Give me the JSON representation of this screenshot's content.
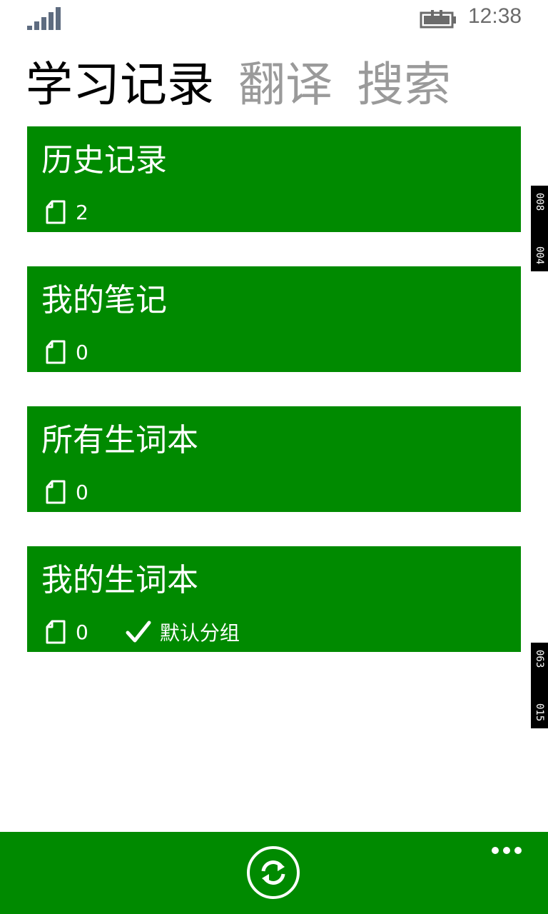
{
  "status": {
    "time": "12:38"
  },
  "pivot": {
    "tabs": [
      "学习记录",
      "翻译",
      "搜索"
    ]
  },
  "tiles": [
    {
      "title": "历史记录",
      "count": "2"
    },
    {
      "title": "我的笔记",
      "count": "0"
    },
    {
      "title": "所有生词本",
      "count": "0"
    },
    {
      "title": "我的生词本",
      "count": "0",
      "group": "默认分组"
    }
  ],
  "side_tags": [
    {
      "a": "008",
      "b": "004"
    },
    {
      "a": "063",
      "b": "015"
    }
  ],
  "colors": {
    "accent": "#008a00",
    "inactive": "#9a9a9a",
    "text_dark": "#000000"
  },
  "icons": [
    "signal-icon",
    "battery-charging-icon",
    "document-icon",
    "checkmark-icon",
    "refresh-icon",
    "more-icon"
  ]
}
